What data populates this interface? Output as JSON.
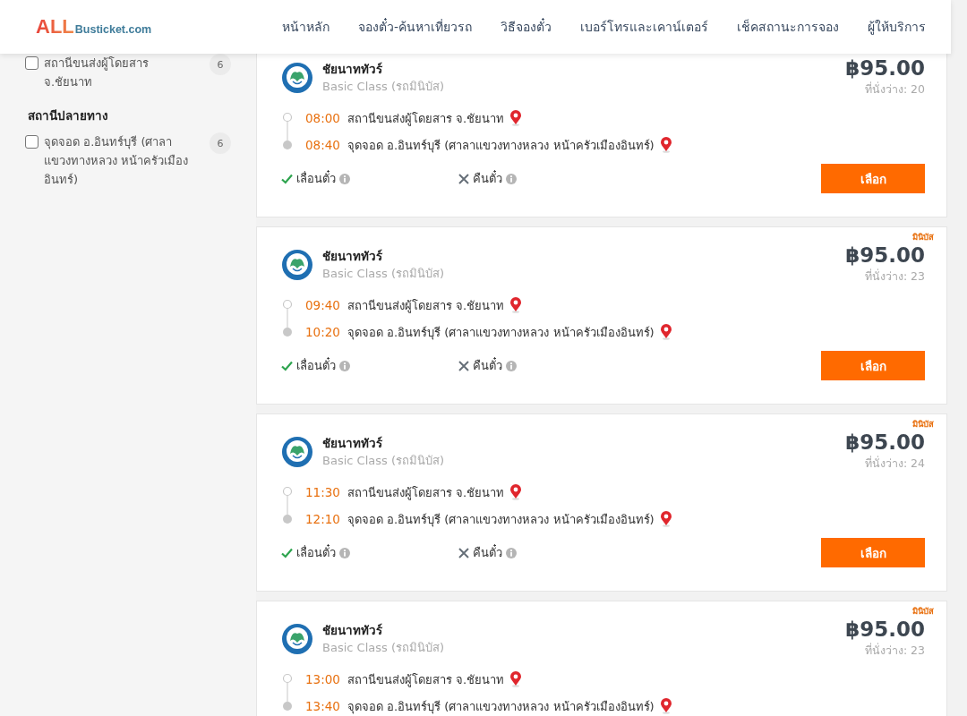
{
  "header": {
    "logo": {
      "main": "ALL",
      "sub": "Busticket.com"
    },
    "nav": [
      {
        "label": "หน้าหลัก"
      },
      {
        "label": "จองตั๋ว-ค้นหาเที่ยวรถ"
      },
      {
        "label": "วิธีจองตั๋ว"
      },
      {
        "label": "เบอร์โทรและเคาน์เตอร์"
      },
      {
        "label": "เช็คสถานะการจอง"
      },
      {
        "label": "ผู้ให้บริการ"
      }
    ]
  },
  "sidebar": {
    "groups": [
      {
        "items": [
          {
            "label": "สถานีขนส่งผู้โดยสาร จ.ชัยนาท",
            "count": "6",
            "checked": false
          }
        ]
      },
      {
        "title": "สถานีปลายทาง",
        "items": [
          {
            "label": "จุดจอด อ.อินทร์บุรี (ศาลาแขวงทางหลวง หน้าครัวเมืองอินทร์)",
            "count": "6",
            "checked": false
          }
        ]
      }
    ]
  },
  "trips": [
    {
      "operator": "ชัยนาททัวร์",
      "class": "Basic Class (รถมินิบัส)",
      "price": "฿95.00",
      "seats": "ที่นั่งว่าง: 20",
      "stops": [
        {
          "time": "08:00",
          "station": "สถานีขนส่งผู้โดยสาร จ.ชัยนาท"
        },
        {
          "time": "08:40",
          "station": "จุดจอด อ.อินทร์บุรี (ศาลาแขวงทางหลวง หน้าครัวเมืองอินทร์)"
        }
      ],
      "features": [
        {
          "label": "เลื่อนตั๋ว",
          "available": true
        },
        {
          "label": "คืนตั๋ว",
          "available": false
        }
      ],
      "button": "เลือก"
    },
    {
      "tag": "มินิบัส",
      "operator": "ชัยนาททัวร์",
      "class": "Basic Class (รถมินิบัส)",
      "price": "฿95.00",
      "seats": "ที่นั่งว่าง: 23",
      "stops": [
        {
          "time": "09:40",
          "station": "สถานีขนส่งผู้โดยสาร จ.ชัยนาท"
        },
        {
          "time": "10:20",
          "station": "จุดจอด อ.อินทร์บุรี (ศาลาแขวงทางหลวง หน้าครัวเมืองอินทร์)"
        }
      ],
      "features": [
        {
          "label": "เลื่อนตั๋ว",
          "available": true
        },
        {
          "label": "คืนตั๋ว",
          "available": false
        }
      ],
      "button": "เลือก"
    },
    {
      "tag": "มินิบัส",
      "operator": "ชัยนาททัวร์",
      "class": "Basic Class (รถมินิบัส)",
      "price": "฿95.00",
      "seats": "ที่นั่งว่าง: 24",
      "stops": [
        {
          "time": "11:30",
          "station": "สถานีขนส่งผู้โดยสาร จ.ชัยนาท"
        },
        {
          "time": "12:10",
          "station": "จุดจอด อ.อินทร์บุรี (ศาลาแขวงทางหลวง หน้าครัวเมืองอินทร์)"
        }
      ],
      "features": [
        {
          "label": "เลื่อนตั๋ว",
          "available": true
        },
        {
          "label": "คืนตั๋ว",
          "available": false
        }
      ],
      "button": "เลือก"
    },
    {
      "tag": "มินิบัส",
      "operator": "ชัยนาททัวร์",
      "class": "Basic Class (รถมินิบัส)",
      "price": "฿95.00",
      "seats": "ที่นั่งว่าง: 23",
      "stops": [
        {
          "time": "13:00",
          "station": "สถานีขนส่งผู้โดยสาร จ.ชัยนาท"
        },
        {
          "time": "13:40",
          "station": "จุดจอด อ.อินทร์บุรี (ศาลาแขวงทางหลวง หน้าครัวเมืองอินทร์)"
        }
      ]
    }
  ]
}
